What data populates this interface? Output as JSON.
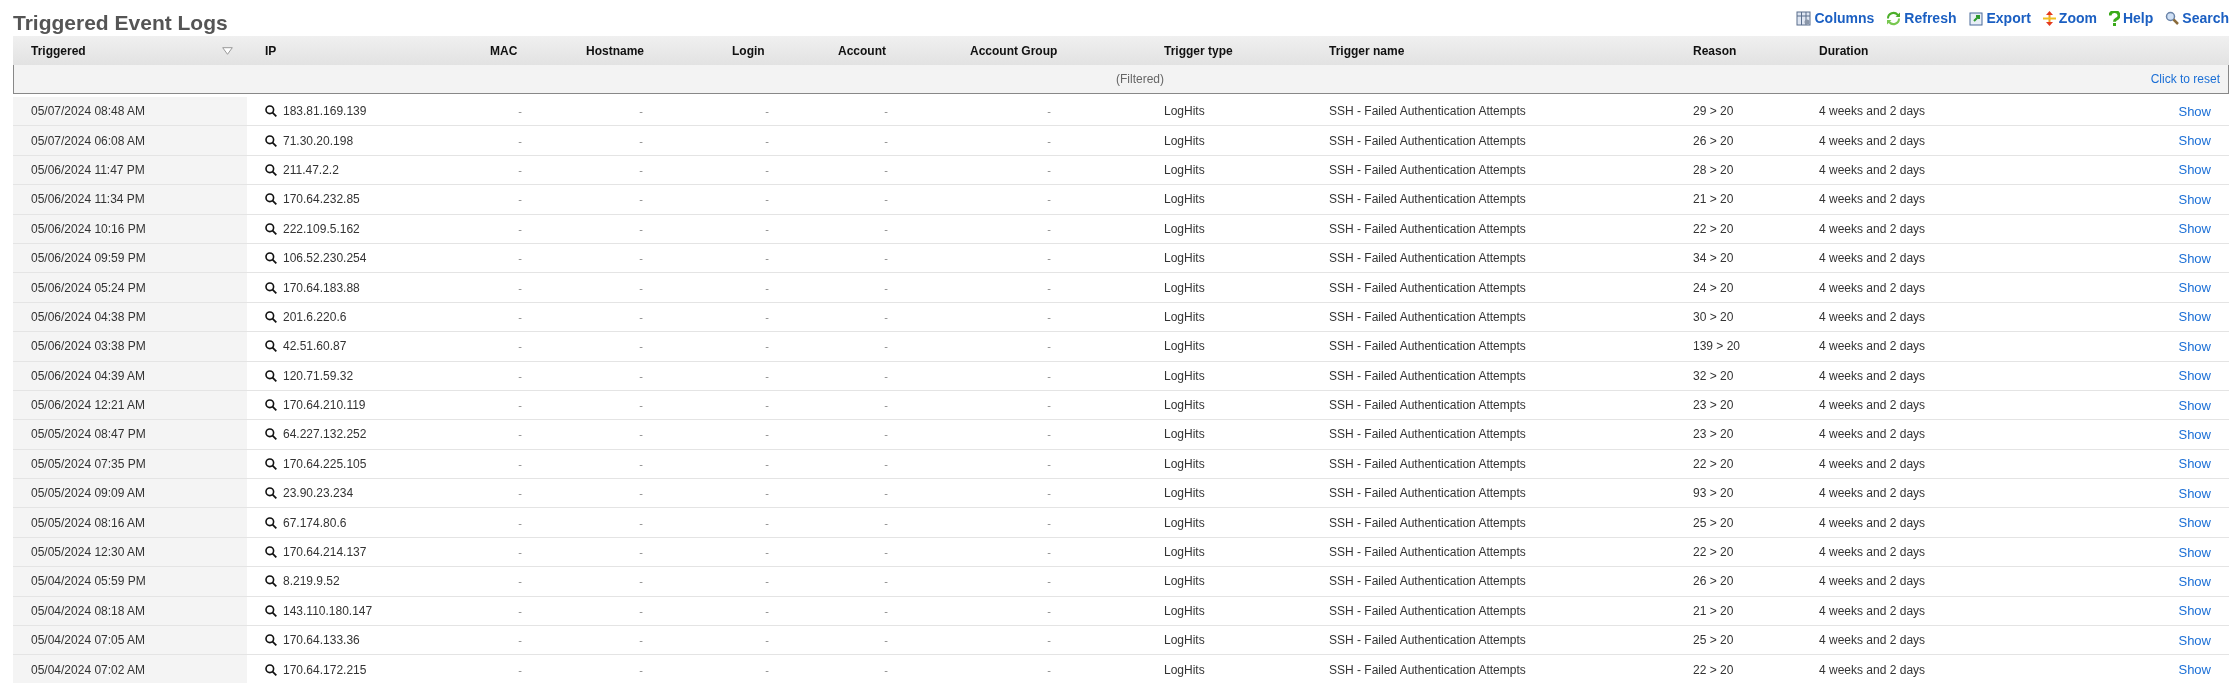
{
  "page_title": "Triggered Event Logs",
  "toolbar": [
    {
      "kind": "columns",
      "label": "Columns"
    },
    {
      "kind": "refresh",
      "label": "Refresh"
    },
    {
      "kind": "export",
      "label": "Export"
    },
    {
      "kind": "zoom",
      "label": "Zoom"
    },
    {
      "kind": "help",
      "label": "Help"
    },
    {
      "kind": "search",
      "label": "Search"
    }
  ],
  "columns": [
    {
      "label": "Triggered",
      "sorted": true
    },
    {
      "label": "IP",
      "sorted": false
    },
    {
      "label": "MAC",
      "sorted": false
    },
    {
      "label": "Hostname",
      "sorted": false
    },
    {
      "label": "Login",
      "sorted": false
    },
    {
      "label": "Account",
      "sorted": false
    },
    {
      "label": "Account Group",
      "sorted": false
    },
    {
      "label": "Trigger type",
      "sorted": false
    },
    {
      "label": "Trigger name",
      "sorted": false
    },
    {
      "label": "Reason",
      "sorted": false
    },
    {
      "label": "Duration",
      "sorted": false
    }
  ],
  "filter_bar": {
    "status": "(Filtered)",
    "reset_link": "Click to reset"
  },
  "rows": [
    {
      "triggered": "05/07/2024 08:48 AM",
      "ip": "183.81.169.139",
      "mac": "-",
      "hostname": "-",
      "login": "-",
      "account": "-",
      "account_group": "-",
      "trigger_type": "LogHits",
      "trigger_name": "SSH - Failed Authentication Attempts",
      "reason": "29 > 20",
      "duration": "4 weeks and 2 days",
      "action": "Show"
    },
    {
      "triggered": "05/07/2024 06:08 AM",
      "ip": "71.30.20.198",
      "mac": "-",
      "hostname": "-",
      "login": "-",
      "account": "-",
      "account_group": "-",
      "trigger_type": "LogHits",
      "trigger_name": "SSH - Failed Authentication Attempts",
      "reason": "26 > 20",
      "duration": "4 weeks and 2 days",
      "action": "Show"
    },
    {
      "triggered": "05/06/2024 11:47 PM",
      "ip": "211.47.2.2",
      "mac": "-",
      "hostname": "-",
      "login": "-",
      "account": "-",
      "account_group": "-",
      "trigger_type": "LogHits",
      "trigger_name": "SSH - Failed Authentication Attempts",
      "reason": "28 > 20",
      "duration": "4 weeks and 2 days",
      "action": "Show"
    },
    {
      "triggered": "05/06/2024 11:34 PM",
      "ip": "170.64.232.85",
      "mac": "-",
      "hostname": "-",
      "login": "-",
      "account": "-",
      "account_group": "-",
      "trigger_type": "LogHits",
      "trigger_name": "SSH - Failed Authentication Attempts",
      "reason": "21 > 20",
      "duration": "4 weeks and 2 days",
      "action": "Show"
    },
    {
      "triggered": "05/06/2024 10:16 PM",
      "ip": "222.109.5.162",
      "mac": "-",
      "hostname": "-",
      "login": "-",
      "account": "-",
      "account_group": "-",
      "trigger_type": "LogHits",
      "trigger_name": "SSH - Failed Authentication Attempts",
      "reason": "22 > 20",
      "duration": "4 weeks and 2 days",
      "action": "Show"
    },
    {
      "triggered": "05/06/2024 09:59 PM",
      "ip": "106.52.230.254",
      "mac": "-",
      "hostname": "-",
      "login": "-",
      "account": "-",
      "account_group": "-",
      "trigger_type": "LogHits",
      "trigger_name": "SSH - Failed Authentication Attempts",
      "reason": "34 > 20",
      "duration": "4 weeks and 2 days",
      "action": "Show"
    },
    {
      "triggered": "05/06/2024 05:24 PM",
      "ip": "170.64.183.88",
      "mac": "-",
      "hostname": "-",
      "login": "-",
      "account": "-",
      "account_group": "-",
      "trigger_type": "LogHits",
      "trigger_name": "SSH - Failed Authentication Attempts",
      "reason": "24 > 20",
      "duration": "4 weeks and 2 days",
      "action": "Show"
    },
    {
      "triggered": "05/06/2024 04:38 PM",
      "ip": "201.6.220.6",
      "mac": "-",
      "hostname": "-",
      "login": "-",
      "account": "-",
      "account_group": "-",
      "trigger_type": "LogHits",
      "trigger_name": "SSH - Failed Authentication Attempts",
      "reason": "30 > 20",
      "duration": "4 weeks and 2 days",
      "action": "Show"
    },
    {
      "triggered": "05/06/2024 03:38 PM",
      "ip": "42.51.60.87",
      "mac": "-",
      "hostname": "-",
      "login": "-",
      "account": "-",
      "account_group": "-",
      "trigger_type": "LogHits",
      "trigger_name": "SSH - Failed Authentication Attempts",
      "reason": "139 > 20",
      "duration": "4 weeks and 2 days",
      "action": "Show"
    },
    {
      "triggered": "05/06/2024 04:39 AM",
      "ip": "120.71.59.32",
      "mac": "-",
      "hostname": "-",
      "login": "-",
      "account": "-",
      "account_group": "-",
      "trigger_type": "LogHits",
      "trigger_name": "SSH - Failed Authentication Attempts",
      "reason": "32 > 20",
      "duration": "4 weeks and 2 days",
      "action": "Show"
    },
    {
      "triggered": "05/06/2024 12:21 AM",
      "ip": "170.64.210.119",
      "mac": "-",
      "hostname": "-",
      "login": "-",
      "account": "-",
      "account_group": "-",
      "trigger_type": "LogHits",
      "trigger_name": "SSH - Failed Authentication Attempts",
      "reason": "23 > 20",
      "duration": "4 weeks and 2 days",
      "action": "Show"
    },
    {
      "triggered": "05/05/2024 08:47 PM",
      "ip": "64.227.132.252",
      "mac": "-",
      "hostname": "-",
      "login": "-",
      "account": "-",
      "account_group": "-",
      "trigger_type": "LogHits",
      "trigger_name": "SSH - Failed Authentication Attempts",
      "reason": "23 > 20",
      "duration": "4 weeks and 2 days",
      "action": "Show"
    },
    {
      "triggered": "05/05/2024 07:35 PM",
      "ip": "170.64.225.105",
      "mac": "-",
      "hostname": "-",
      "login": "-",
      "account": "-",
      "account_group": "-",
      "trigger_type": "LogHits",
      "trigger_name": "SSH - Failed Authentication Attempts",
      "reason": "22 > 20",
      "duration": "4 weeks and 2 days",
      "action": "Show"
    },
    {
      "triggered": "05/05/2024 09:09 AM",
      "ip": "23.90.23.234",
      "mac": "-",
      "hostname": "-",
      "login": "-",
      "account": "-",
      "account_group": "-",
      "trigger_type": "LogHits",
      "trigger_name": "SSH - Failed Authentication Attempts",
      "reason": "93 > 20",
      "duration": "4 weeks and 2 days",
      "action": "Show"
    },
    {
      "triggered": "05/05/2024 08:16 AM",
      "ip": "67.174.80.6",
      "mac": "-",
      "hostname": "-",
      "login": "-",
      "account": "-",
      "account_group": "-",
      "trigger_type": "LogHits",
      "trigger_name": "SSH - Failed Authentication Attempts",
      "reason": "25 > 20",
      "duration": "4 weeks and 2 days",
      "action": "Show"
    },
    {
      "triggered": "05/05/2024 12:30 AM",
      "ip": "170.64.214.137",
      "mac": "-",
      "hostname": "-",
      "login": "-",
      "account": "-",
      "account_group": "-",
      "trigger_type": "LogHits",
      "trigger_name": "SSH - Failed Authentication Attempts",
      "reason": "22 > 20",
      "duration": "4 weeks and 2 days",
      "action": "Show"
    },
    {
      "triggered": "05/04/2024 05:59 PM",
      "ip": "8.219.9.52",
      "mac": "-",
      "hostname": "-",
      "login": "-",
      "account": "-",
      "account_group": "-",
      "trigger_type": "LogHits",
      "trigger_name": "SSH - Failed Authentication Attempts",
      "reason": "26 > 20",
      "duration": "4 weeks and 2 days",
      "action": "Show"
    },
    {
      "triggered": "05/04/2024 08:18 AM",
      "ip": "143.110.180.147",
      "mac": "-",
      "hostname": "-",
      "login": "-",
      "account": "-",
      "account_group": "-",
      "trigger_type": "LogHits",
      "trigger_name": "SSH - Failed Authentication Attempts",
      "reason": "21 > 20",
      "duration": "4 weeks and 2 days",
      "action": "Show"
    },
    {
      "triggered": "05/04/2024 07:05 AM",
      "ip": "170.64.133.36",
      "mac": "-",
      "hostname": "-",
      "login": "-",
      "account": "-",
      "account_group": "-",
      "trigger_type": "LogHits",
      "trigger_name": "SSH - Failed Authentication Attempts",
      "reason": "25 > 20",
      "duration": "4 weeks and 2 days",
      "action": "Show"
    },
    {
      "triggered": "05/04/2024 07:02 AM",
      "ip": "170.64.172.215",
      "mac": "-",
      "hostname": "-",
      "login": "-",
      "account": "-",
      "account_group": "-",
      "trigger_type": "LogHits",
      "trigger_name": "SSH - Failed Authentication Attempts",
      "reason": "22 > 20",
      "duration": "4 weeks and 2 days",
      "action": "Show"
    }
  ]
}
